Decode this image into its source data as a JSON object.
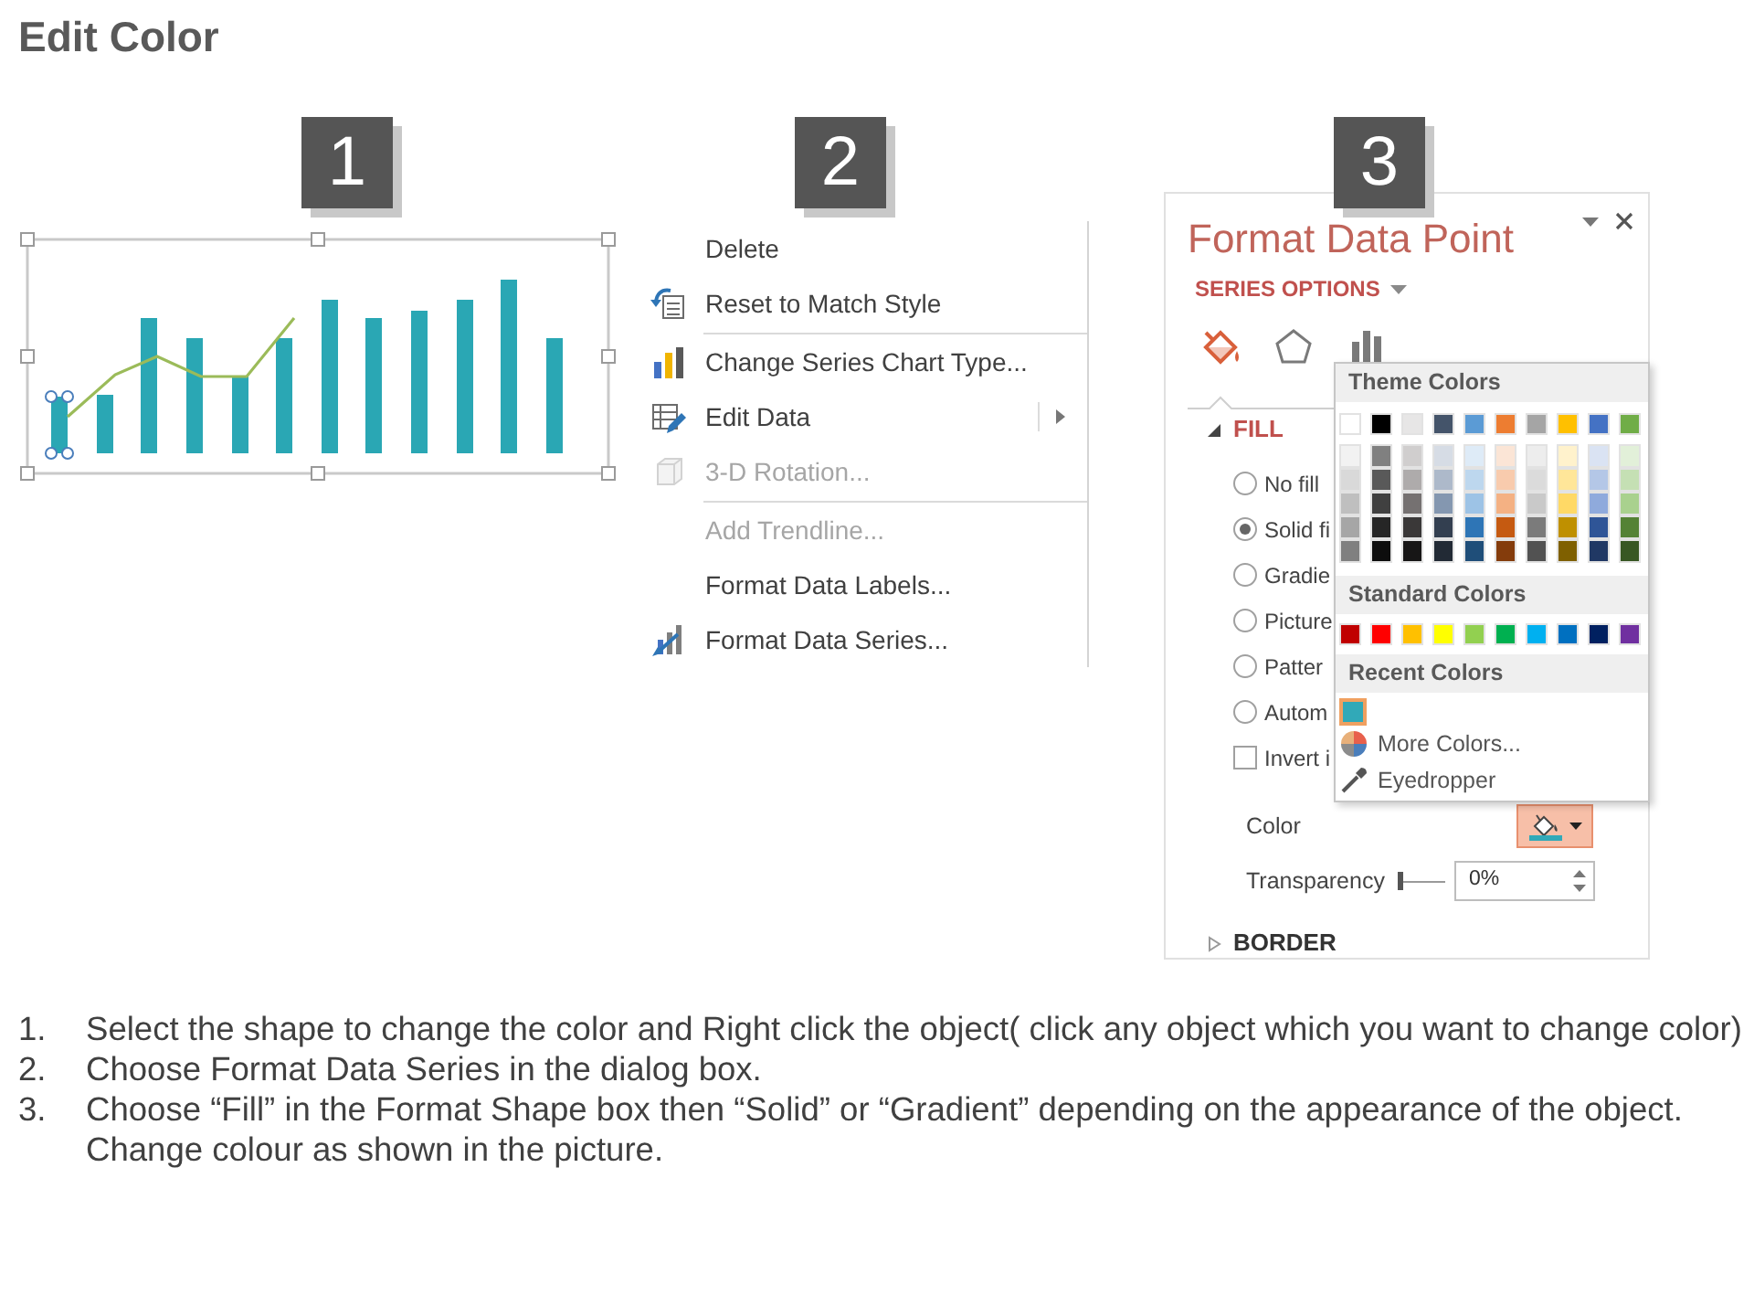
{
  "slide": {
    "title": "Edit Color"
  },
  "steps": [
    {
      "number": "1"
    },
    {
      "number": "2"
    },
    {
      "number": "3"
    }
  ],
  "context_menu": {
    "items": [
      {
        "kind": "item",
        "label": "Delete",
        "disabled": false,
        "submenu": false
      },
      {
        "kind": "item",
        "label": "Reset to Match Style",
        "disabled": false,
        "submenu": false
      },
      {
        "kind": "separator"
      },
      {
        "kind": "item",
        "label": "Change Series Chart Type...",
        "disabled": false,
        "submenu": false
      },
      {
        "kind": "item",
        "label": "Edit Data",
        "disabled": false,
        "submenu": true
      },
      {
        "kind": "item",
        "label": "3-D Rotation...",
        "disabled": true,
        "submenu": false
      },
      {
        "kind": "separator"
      },
      {
        "kind": "item",
        "label": "Add Trendline...",
        "disabled": true,
        "submenu": false
      },
      {
        "kind": "item",
        "label": "Format Data Labels...",
        "disabled": false,
        "submenu": false
      },
      {
        "kind": "item",
        "label": "Format Data Series...",
        "disabled": false,
        "submenu": false
      }
    ]
  },
  "format_pane": {
    "title": "Format Data Point",
    "options_menu": "SERIES OPTIONS",
    "option_tabs": [
      {
        "selected": true
      },
      {
        "selected": false
      },
      {
        "selected": false
      }
    ],
    "fill_section": {
      "title": "FILL",
      "expanded": true,
      "options": [
        {
          "kind": "radio",
          "label": "No fill",
          "selected": false
        },
        {
          "kind": "radio",
          "label": "Solid fi",
          "selected": true
        },
        {
          "kind": "radio",
          "label": "Gradie",
          "selected": false
        },
        {
          "kind": "radio",
          "label": "Picture",
          "selected": false
        },
        {
          "kind": "radio",
          "label": "Patter",
          "selected": false
        },
        {
          "kind": "radio",
          "label": "Autom",
          "selected": false
        },
        {
          "kind": "checkbox",
          "label": "Invert i",
          "checked": false
        }
      ]
    },
    "color": {
      "label": "Color",
      "open": true
    },
    "color_picker": {
      "theme_title": "Theme Colors",
      "theme_colors": [
        {
          "color": "#ffffff",
          "shades": [
            {
              "color": "#f2f2f2"
            },
            {
              "color": "#d9d9d9"
            },
            {
              "color": "#bfbfbf"
            },
            {
              "color": "#a6a6a6"
            },
            {
              "color": "#808080"
            }
          ]
        },
        {
          "color": "#000000",
          "shades": [
            {
              "color": "#808080"
            },
            {
              "color": "#595959"
            },
            {
              "color": "#404040"
            },
            {
              "color": "#262626"
            },
            {
              "color": "#0d0d0d"
            }
          ]
        },
        {
          "color": "#e7e6e6",
          "shades": [
            {
              "color": "#d0cece"
            },
            {
              "color": "#aeabab"
            },
            {
              "color": "#757171"
            },
            {
              "color": "#3a3838"
            },
            {
              "color": "#171616"
            }
          ]
        },
        {
          "color": "#44546a",
          "shades": [
            {
              "color": "#d6dce5"
            },
            {
              "color": "#adb9ca"
            },
            {
              "color": "#8497b0"
            },
            {
              "color": "#333f50"
            },
            {
              "color": "#222a35"
            }
          ]
        },
        {
          "color": "#5b9bd5",
          "shades": [
            {
              "color": "#deebf7"
            },
            {
              "color": "#bdd7ee"
            },
            {
              "color": "#9dc3e6"
            },
            {
              "color": "#2e75b6"
            },
            {
              "color": "#1f4e79"
            }
          ]
        },
        {
          "color": "#ed7d31",
          "shades": [
            {
              "color": "#fbe5d6"
            },
            {
              "color": "#f8cbad"
            },
            {
              "color": "#f4b183"
            },
            {
              "color": "#c55a11"
            },
            {
              "color": "#843c0c"
            }
          ]
        },
        {
          "color": "#a5a5a5",
          "shades": [
            {
              "color": "#ededed"
            },
            {
              "color": "#dbdbdb"
            },
            {
              "color": "#c9c9c9"
            },
            {
              "color": "#7b7b7b"
            },
            {
              "color": "#525252"
            }
          ]
        },
        {
          "color": "#ffc000",
          "shades": [
            {
              "color": "#fff2cc"
            },
            {
              "color": "#ffe699"
            },
            {
              "color": "#ffd966"
            },
            {
              "color": "#bf9000"
            },
            {
              "color": "#7f6000"
            }
          ]
        },
        {
          "color": "#4472c4",
          "shades": [
            {
              "color": "#dae3f3"
            },
            {
              "color": "#b4c7e7"
            },
            {
              "color": "#8faadc"
            },
            {
              "color": "#2f5597"
            },
            {
              "color": "#203864"
            }
          ]
        },
        {
          "color": "#70ad47",
          "shades": [
            {
              "color": "#e2f0d9"
            },
            {
              "color": "#c5e0b4"
            },
            {
              "color": "#a9d18e"
            },
            {
              "color": "#548235"
            },
            {
              "color": "#385723"
            }
          ]
        }
      ],
      "standard_title": "Standard Colors",
      "standard_colors": [
        {
          "color": "#c00000"
        },
        {
          "color": "#ff0000"
        },
        {
          "color": "#ffc000"
        },
        {
          "color": "#ffff00"
        },
        {
          "color": "#92d050"
        },
        {
          "color": "#00b050"
        },
        {
          "color": "#00b0f0"
        },
        {
          "color": "#0070c0"
        },
        {
          "color": "#002060"
        },
        {
          "color": "#7030a0"
        }
      ],
      "recent_title": "Recent Colors",
      "recent_colors": [
        {
          "color": "#31a9b8",
          "selected": true
        }
      ],
      "actions": [
        {
          "label": "More Colors..."
        },
        {
          "label": "Eyedropper"
        }
      ]
    },
    "transparency": {
      "label": "Transparency",
      "level": 0,
      "value": "0%"
    },
    "border_section": {
      "title": "BORDER",
      "expanded": false
    }
  },
  "instructions": [
    {
      "number": "1.",
      "text": "Select the shape to change the color and Right click the object( click any object which you want to change color)"
    },
    {
      "number": "2.",
      "text": "Choose Format Data Series in the dialog box."
    },
    {
      "number": "3.",
      "text": "Choose “Fill” in the Format Shape box then “Solid” or “Gradient” depending on the appearance of the object. Change colour as shown in the picture."
    }
  ]
}
